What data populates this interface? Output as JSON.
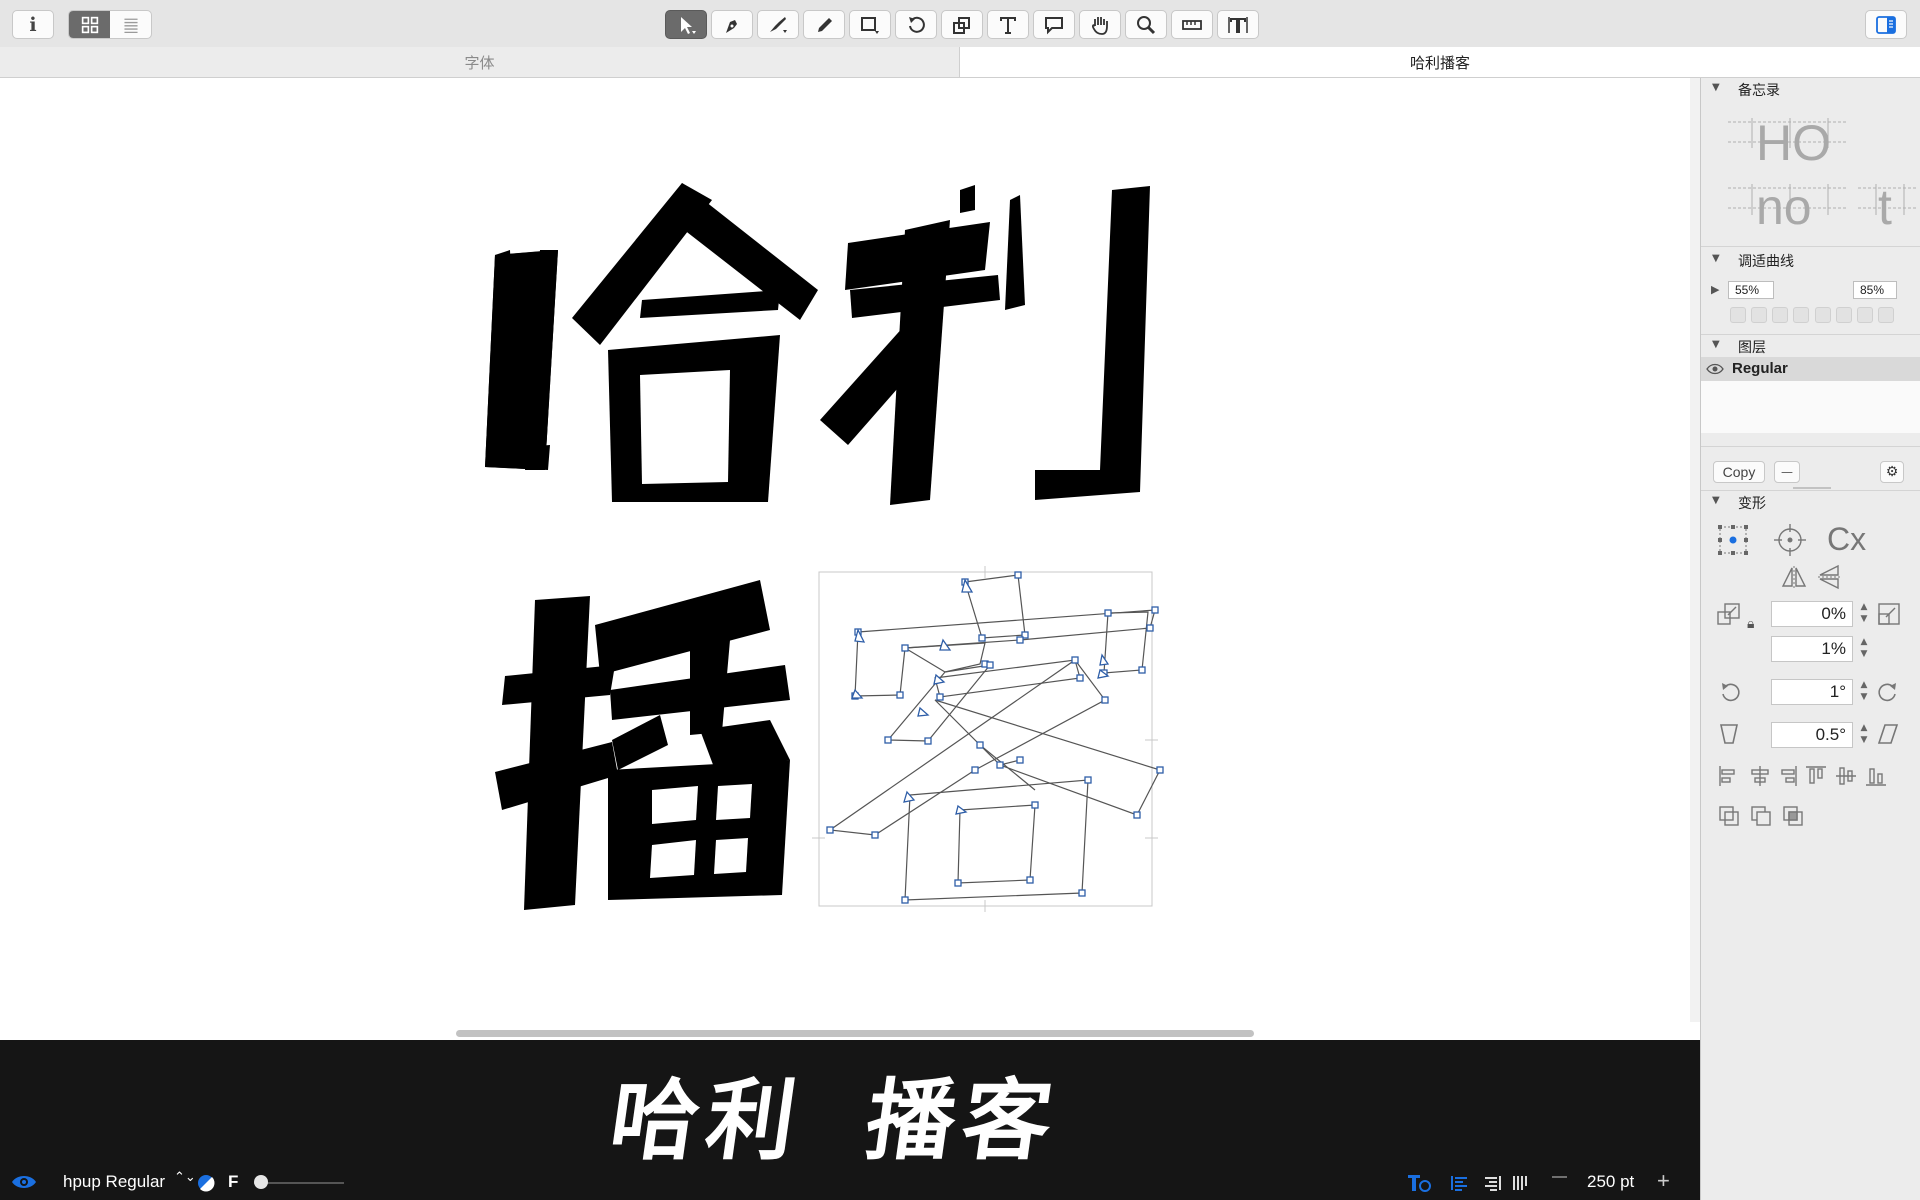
{
  "toolbar": {
    "info_icon": "info-icon",
    "view_grid_icon": "grid-view-icon",
    "view_list_icon": "list-view-icon",
    "tools": [
      "select-tool-icon",
      "draw-tool-icon",
      "pen-tool-icon",
      "pencil-tool-icon",
      "rectangle-tool-icon",
      "rotate-tool-icon",
      "scale-tool-icon",
      "text-tool-icon",
      "annotation-tool-icon",
      "hand-tool-icon",
      "zoom-tool-icon",
      "measure-tool-icon",
      "metrics-tool-icon"
    ],
    "sidebar_toggle_icon": "sidebar-toggle-icon"
  },
  "tabs": {
    "fonts_label": "字体",
    "active_label": "哈利播客"
  },
  "glyphs": {
    "top": "哈利",
    "bottom_left": "播"
  },
  "preview": {
    "text_left": "哈利",
    "text_right": "播客"
  },
  "bottombar": {
    "master_name": "hpup Regular",
    "font_indicator": "F",
    "size_value": "250 pt",
    "minus": "—",
    "plus": "+"
  },
  "sidebar": {
    "notes": {
      "title": "备忘录"
    },
    "kerning_preview": {
      "line1": "HO",
      "line2": "no",
      "line3": "t"
    },
    "curve": {
      "title": "调适曲线",
      "left_value": "55%",
      "right_value": "85%"
    },
    "layers": {
      "title": "图层",
      "items": [
        "Regular"
      ]
    },
    "copy_button": "Copy",
    "remove_button": "—",
    "transform": {
      "title": "变形",
      "cx_label": "Cx",
      "scale_x": "0%",
      "scale_y": "1%",
      "rotate": "1°",
      "slant": "0.5°"
    }
  },
  "colors": {
    "accent": "#1a6fe0",
    "preview_bg": "#151515",
    "node_blue": "#2e5ea8"
  }
}
